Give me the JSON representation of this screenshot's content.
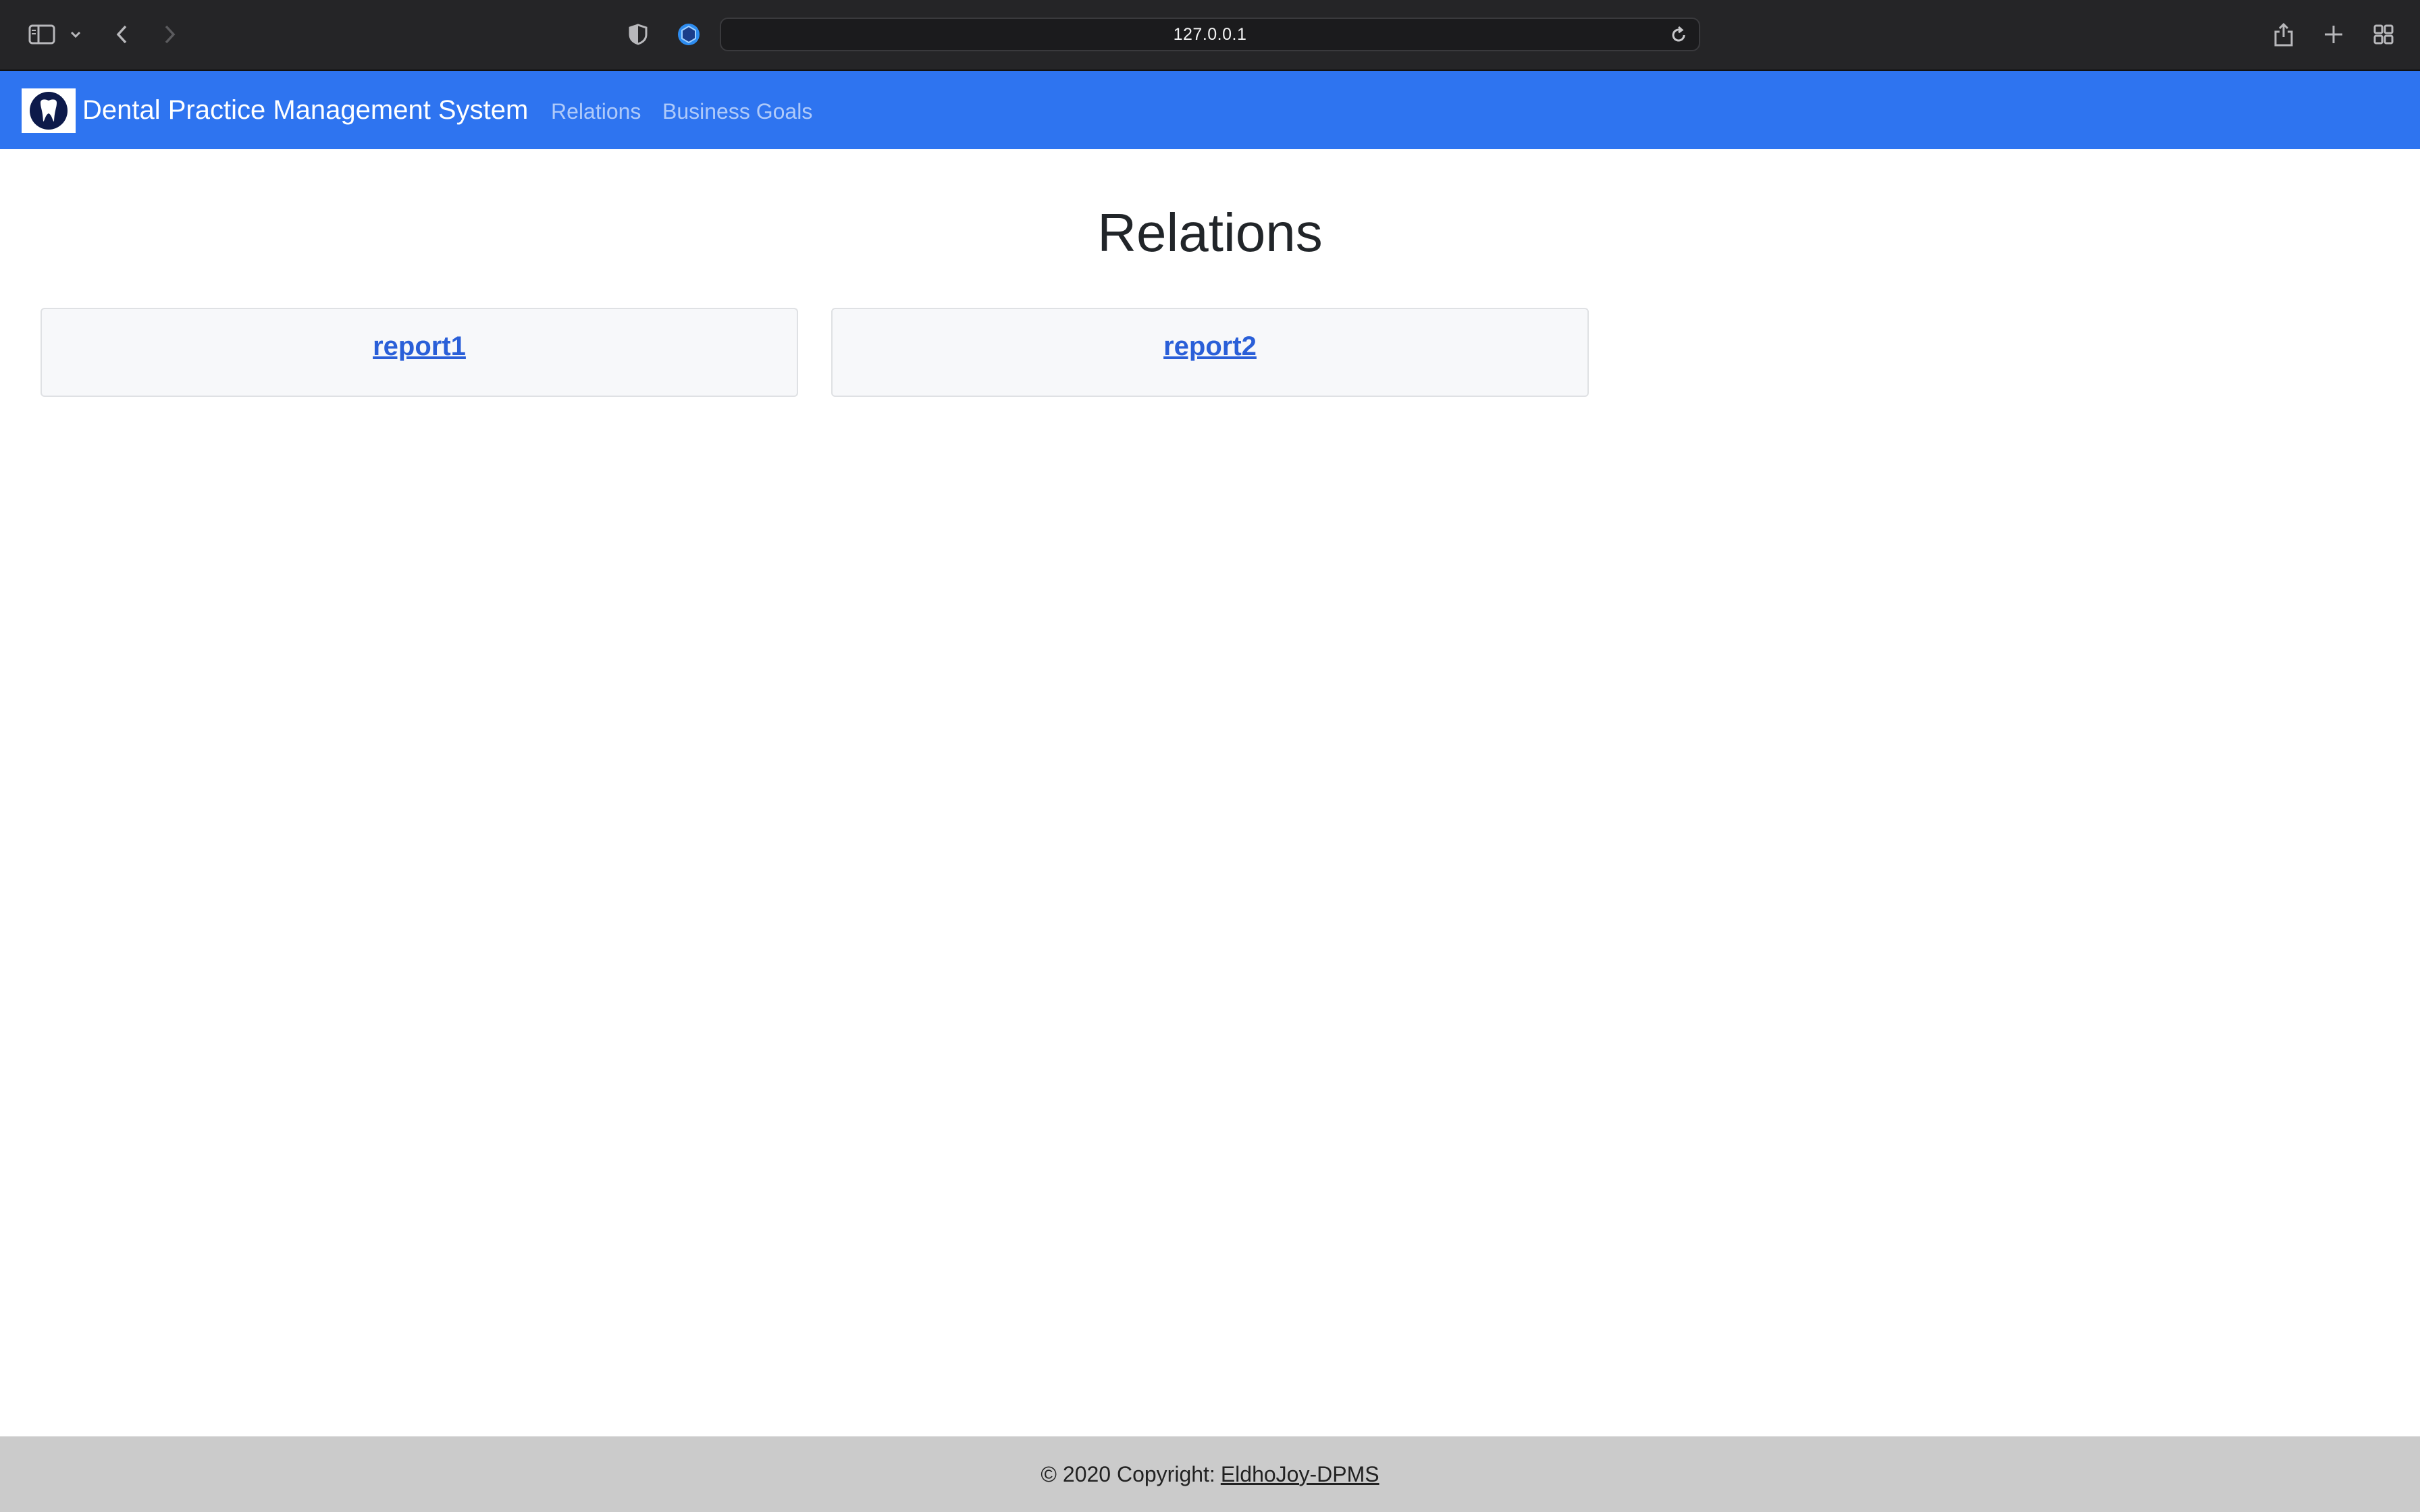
{
  "browser": {
    "url": "127.0.0.1"
  },
  "navbar": {
    "brand_title": "Dental Practice Management System",
    "links": [
      {
        "label": "Relations"
      },
      {
        "label": "Business Goals"
      }
    ],
    "color": "#2e74f0"
  },
  "main": {
    "title": "Relations",
    "cards": [
      {
        "label": "report1"
      },
      {
        "label": "report2"
      }
    ]
  },
  "footer": {
    "copyright_text": "© 2020 Copyright:",
    "link_text": "EldhoJoy-DPMS"
  }
}
